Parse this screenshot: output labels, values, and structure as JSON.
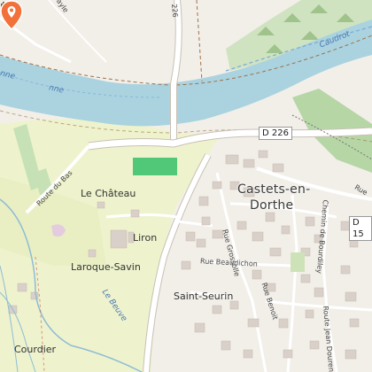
{
  "map": {
    "places": {
      "castets": "Castets-en-",
      "dorthe": "Dorthe",
      "le_chateau": "Le Château",
      "liron": "Liron",
      "laroque": "Laroque-Savin",
      "saint_seurin": "Saint-Seurin",
      "courdier": "Courdier"
    },
    "roads": {
      "d226_top": "226",
      "d226_shield": "D 226",
      "d15_shield": "D 15",
      "route_bas": "Route du Bas",
      "rue_grosolle": "Rue Grossolle",
      "rue_beaudichon": "Rue Beaudichon",
      "rue_benoit": "Rue Benoit",
      "chemin_bourdiley": "Chemin de Bourdiley",
      "rue_jean_dourens": "Route Jean Dourens",
      "rue_right": "Rue",
      "ayle": "ayle"
    },
    "water": {
      "canal": "Caudrot",
      "river_a": "nne",
      "river_b": "nne",
      "beuve": "Le Beuve"
    },
    "colors": {
      "river": "#aad3df",
      "land": "#f2efe9",
      "meadow": "#f0f5cf",
      "forest": "#aed1a0",
      "sports": "#50c878",
      "road": "#ffffff",
      "building": "#d9d0c9",
      "marker": "#f2713a"
    },
    "icons": {
      "marker": "map-marker-icon",
      "castle": "castle-icon"
    }
  }
}
